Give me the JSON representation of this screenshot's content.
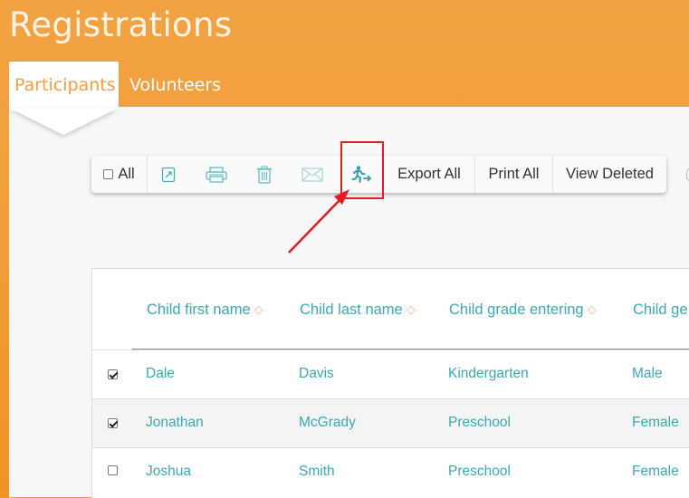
{
  "page": {
    "title": "Registrations"
  },
  "tabs": [
    {
      "label": "Participants",
      "active": true
    },
    {
      "label": "Volunteers",
      "active": false
    }
  ],
  "toolbar": {
    "select_all_label": "All",
    "select_all_checked": false,
    "icons": [
      "open-icon",
      "print-icon",
      "trash-icon",
      "mail-icon",
      "runner-exit-icon"
    ],
    "export_all_label": "Export All",
    "print_all_label": "Print All",
    "view_deleted_label": "View Deleted"
  },
  "table": {
    "columns": [
      "Child first name",
      "Child last name",
      "Child grade entering",
      "Child ge"
    ],
    "rows": [
      {
        "checked": true,
        "first": "Dale",
        "last": "Davis",
        "grade": "Kindergarten",
        "gender": "Male"
      },
      {
        "checked": true,
        "first": "Jonathan",
        "last": "McGrady",
        "grade": "Preschool",
        "gender": "Female"
      },
      {
        "checked": false,
        "first": "Joshua",
        "last": "Smith",
        "grade": "Preschool",
        "gender": "Female"
      }
    ]
  },
  "colors": {
    "header_orange": "#f2a03f",
    "teal_text": "#3aa9b5",
    "annotation_red": "#e31b23"
  }
}
